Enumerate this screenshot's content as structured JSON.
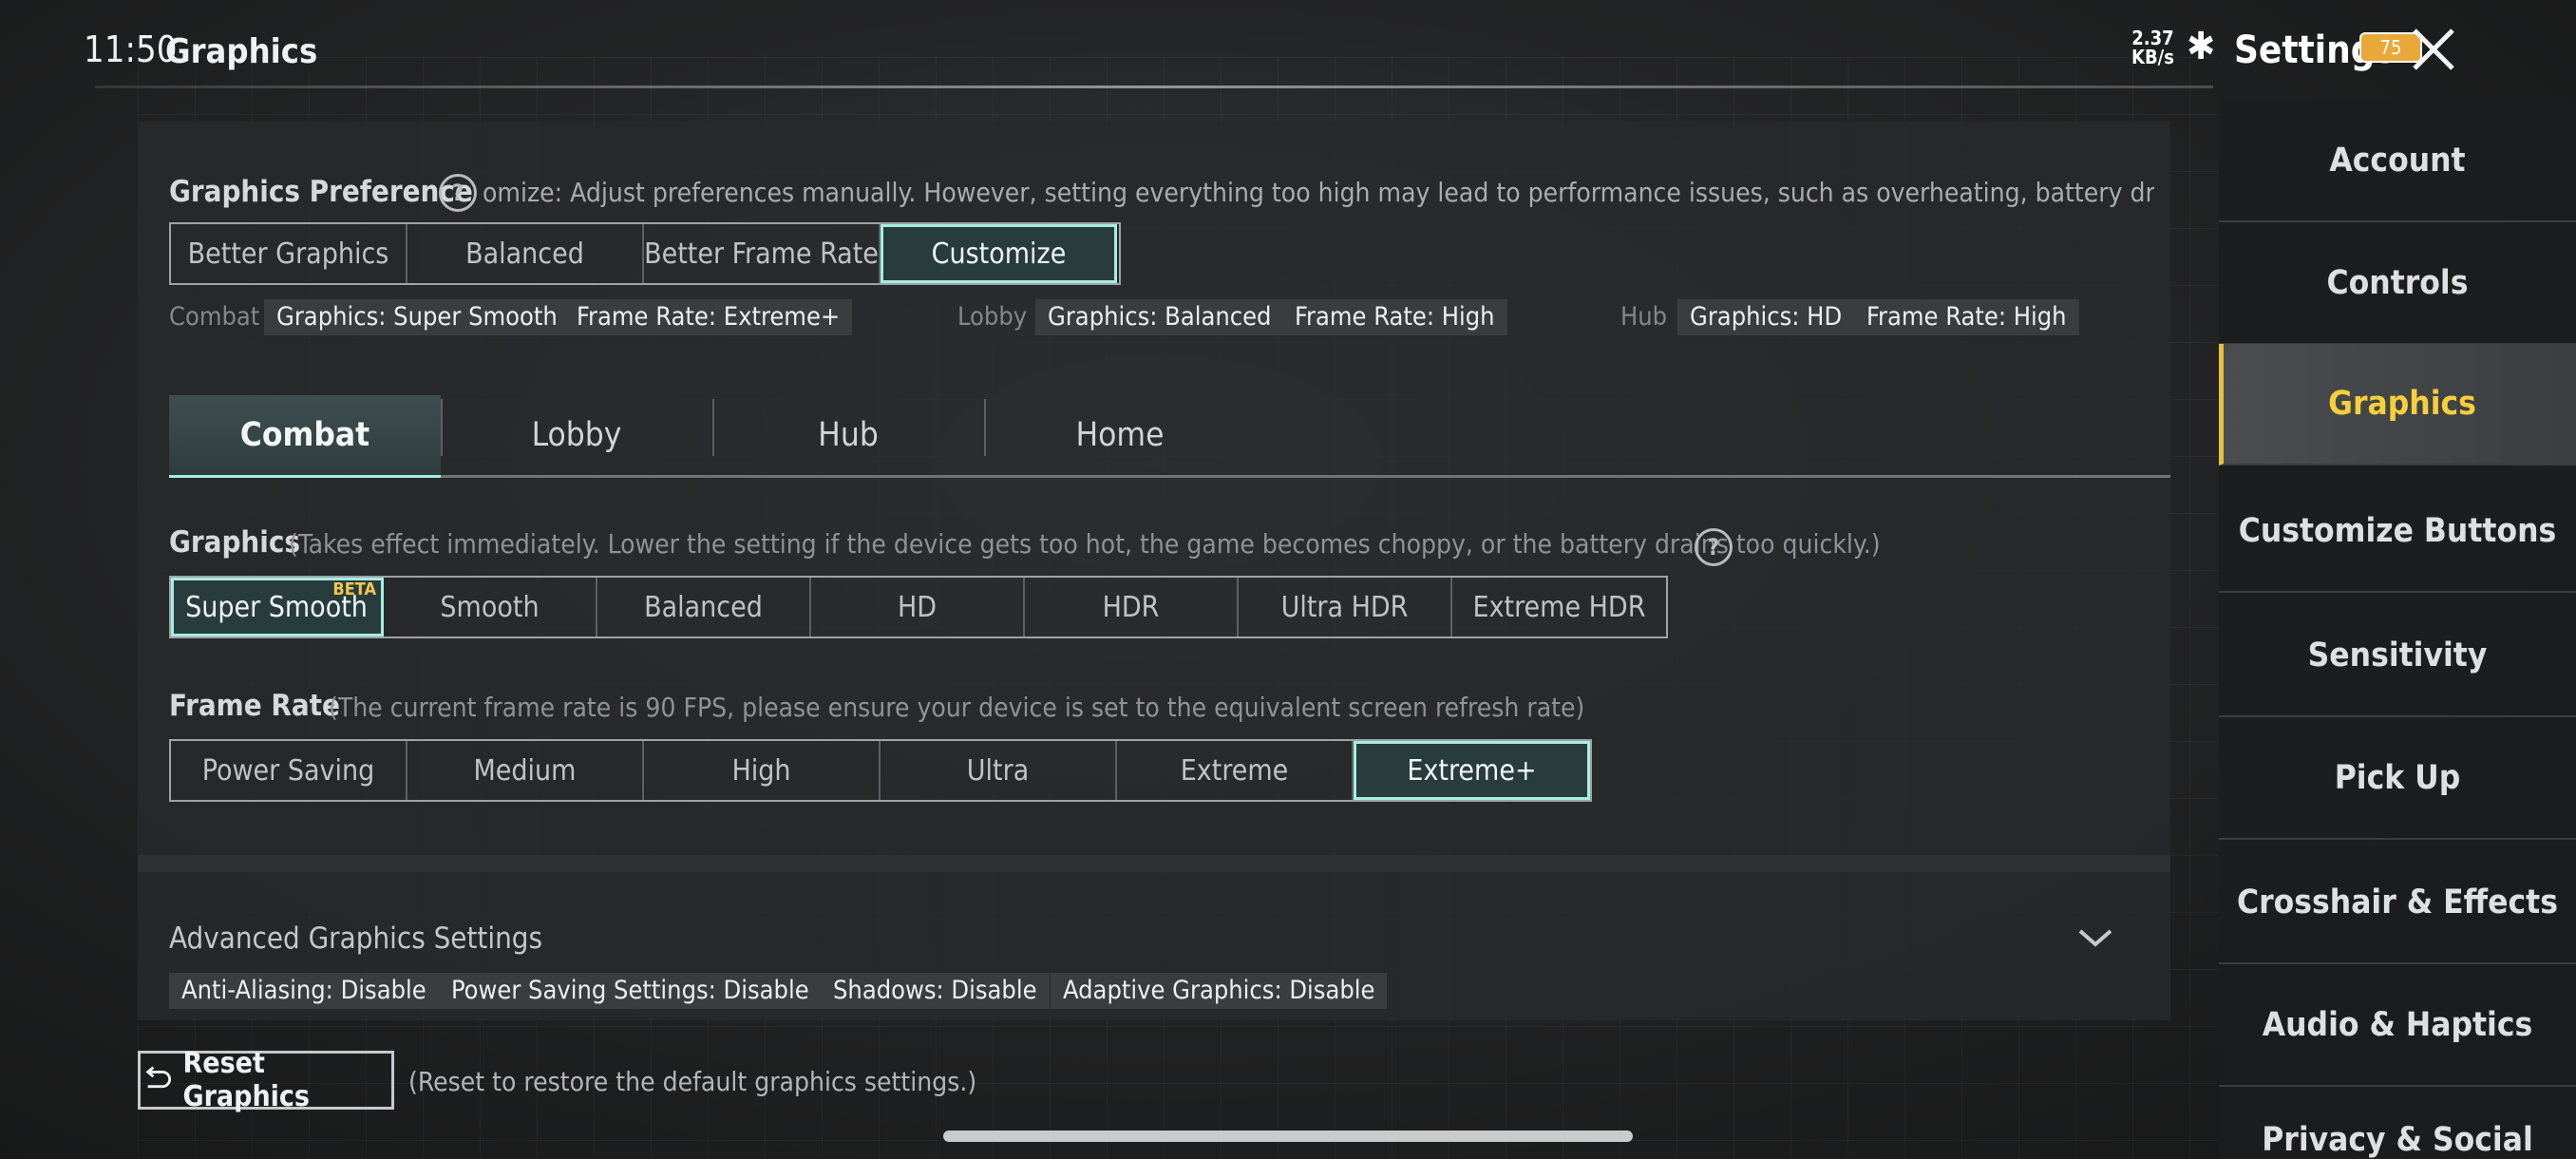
{
  "status_bar": {
    "time": "11:50",
    "net_speed_value": "2.37",
    "net_speed_unit": "KB/s",
    "battery": "75"
  },
  "header": {
    "page_title": "Graphics",
    "settings_title": "Settings"
  },
  "preference": {
    "label": "Graphics Preference",
    "help_text": "omize: Adjust preferences manually. However, setting everything too high may lead to performance issues, such as overheating, battery drain, or choppy",
    "options": [
      "Better Graphics",
      "Balanced",
      "Better Frame Rate",
      "Customize"
    ],
    "selected": "Customize"
  },
  "summary": {
    "combat_label": "Combat",
    "combat_graphics": "Graphics: Super Smooth",
    "combat_fps": "Frame Rate: Extreme+",
    "lobby_label": "Lobby",
    "lobby_graphics": "Graphics: Balanced",
    "lobby_fps": "Frame Rate: High",
    "hub_label": "Hub",
    "hub_graphics": "Graphics: HD",
    "hub_fps": "Frame Rate: High"
  },
  "tabs": [
    "Combat",
    "Lobby",
    "Hub",
    "Home"
  ],
  "graphics": {
    "label": "Graphics",
    "note": "(Takes effect immediately. Lower the setting if the device gets too hot, the game becomes choppy, or the battery drains too quickly.)",
    "options": [
      "Super Smooth",
      "Smooth",
      "Balanced",
      "HD",
      "HDR",
      "Ultra HDR",
      "Extreme HDR"
    ],
    "selected": "Super Smooth",
    "beta_badge": "BETA"
  },
  "frame_rate": {
    "label": "Frame Rate",
    "note": "(The current frame rate is 90 FPS, please ensure your device is set to the equivalent screen refresh rate)",
    "options": [
      "Power Saving",
      "Medium",
      "High",
      "Ultra",
      "Extreme",
      "Extreme+"
    ],
    "selected": "Extreme+"
  },
  "advanced": {
    "label": "Advanced Graphics Settings",
    "tags": [
      "Anti-Aliasing: Disable",
      "Power Saving Settings: Disable",
      "Shadows: Disable",
      "Adaptive Graphics: Disable"
    ]
  },
  "reset": {
    "label": "Reset Graphics",
    "note": "(Reset to restore the default graphics settings.)"
  },
  "sidebar": {
    "items": [
      "Account",
      "Controls",
      "Graphics",
      "Customize Buttons",
      "Sensitivity",
      "Pick Up",
      "Crosshair & Effects",
      "Audio & Haptics",
      "Privacy & Social"
    ],
    "selected": "Graphics"
  },
  "colors": {
    "accent_teal": "#a6ede0",
    "accent_yellow": "#f6cf3d",
    "beta": "#f0c94a"
  }
}
